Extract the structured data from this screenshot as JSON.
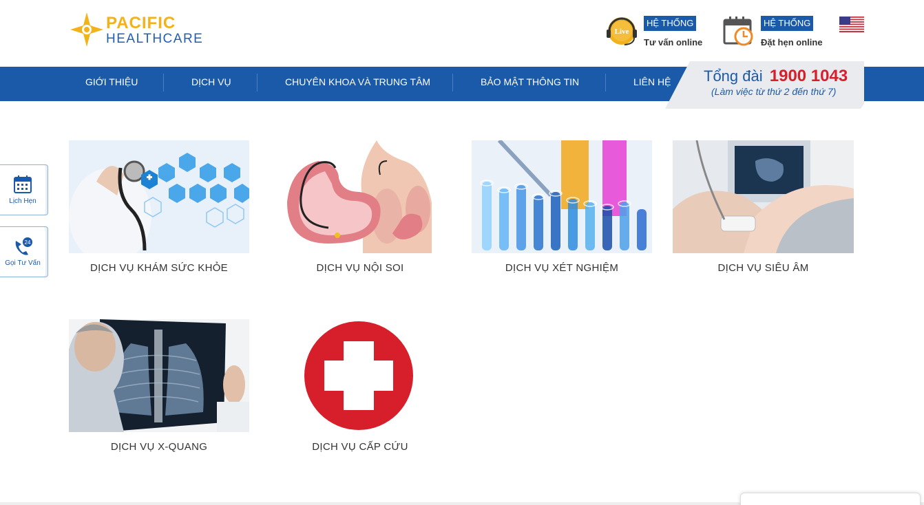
{
  "brand": {
    "name_top": "PACIFIC",
    "name_bottom": "HEALTHCARE"
  },
  "header_tools": [
    {
      "badge": "HỆ THỐNG",
      "subtitle": "Tư vấn online",
      "icon": "live-chat-icon",
      "icon_text": "Live"
    },
    {
      "badge": "HỆ THỐNG",
      "subtitle": "Đặt hẹn online",
      "icon": "calendar-clock-icon"
    }
  ],
  "language_flag": "us-flag-icon",
  "nav": {
    "items": [
      "GIỚI THIỆU",
      "DỊCH VỤ",
      "CHUYÊN KHOA VÀ TRUNG TÂM",
      "BẢO MẬT THÔNG TIN",
      "LIÊN HỆ"
    ]
  },
  "hotline": {
    "label": "Tổng đài",
    "number": "1900 1043",
    "hours": "(Làm việc từ thứ 2 đến thứ 7)"
  },
  "side_buttons": [
    {
      "label": "Lịch Hẹn",
      "icon": "calendar-icon"
    },
    {
      "label": "Gọi Tư Vấn",
      "icon": "phone-24-icon",
      "icon_text": "24"
    }
  ],
  "services": [
    {
      "title": "DỊCH VỤ KHÁM SỨC KHỎE",
      "image": "stethoscope-medical-icons-image"
    },
    {
      "title": "DỊCH VỤ NỘI SOI",
      "image": "stomach-endoscopy-image"
    },
    {
      "title": "DỊCH VỤ XÉT NGHIỆM",
      "image": "test-tubes-image"
    },
    {
      "title": "DỊCH VỤ SIÊU ÂM",
      "image": "ultrasound-scan-image"
    },
    {
      "title": "DỊCH VỤ X-QUANG",
      "image": "doctor-xray-image"
    },
    {
      "title": "DỊCH VỤ CẤP CỨU",
      "image": "emergency-red-cross-image"
    }
  ],
  "colors": {
    "primary_blue": "#1a5aa8",
    "brand_yellow": "#f3b21a",
    "hotline_red": "#d71f2b",
    "emergency_red": "#d71f2b"
  }
}
